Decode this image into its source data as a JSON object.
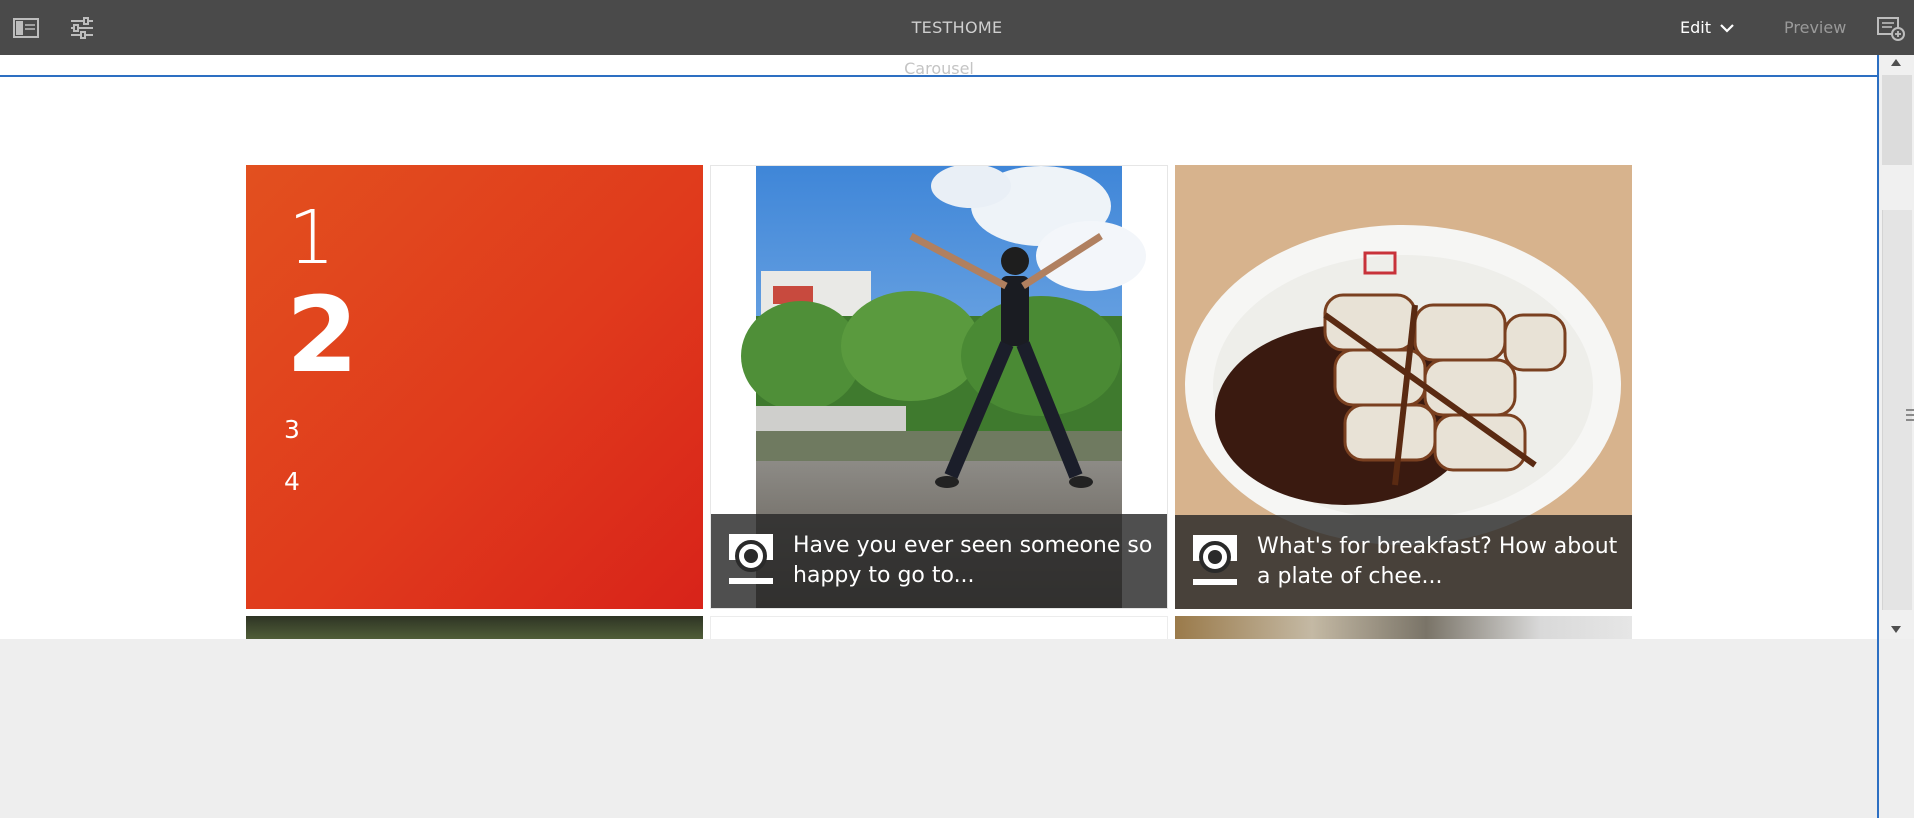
{
  "toolbar": {
    "page_title": "TESTHOME",
    "mode_label": "Edit",
    "preview_label": "Preview",
    "icons": {
      "side_panel": "side-panel-icon",
      "properties": "page-properties-icon",
      "mode_dropdown": "chevron-down-icon",
      "annotate": "annotations-icon"
    }
  },
  "editor": {
    "component_label": "Carousel",
    "accent_color": "#2d6fc2"
  },
  "tiles": {
    "red_tile": {
      "lines": [
        "1",
        "2",
        "3",
        "4"
      ],
      "color": "#e03a1c"
    },
    "post1": {
      "caption": "Have you ever seen someone so happy to go to...",
      "icon": "instagram-icon"
    },
    "post2": {
      "caption": "What's for breakfast? How about a plate of chee...",
      "icon": "instagram-icon"
    }
  }
}
